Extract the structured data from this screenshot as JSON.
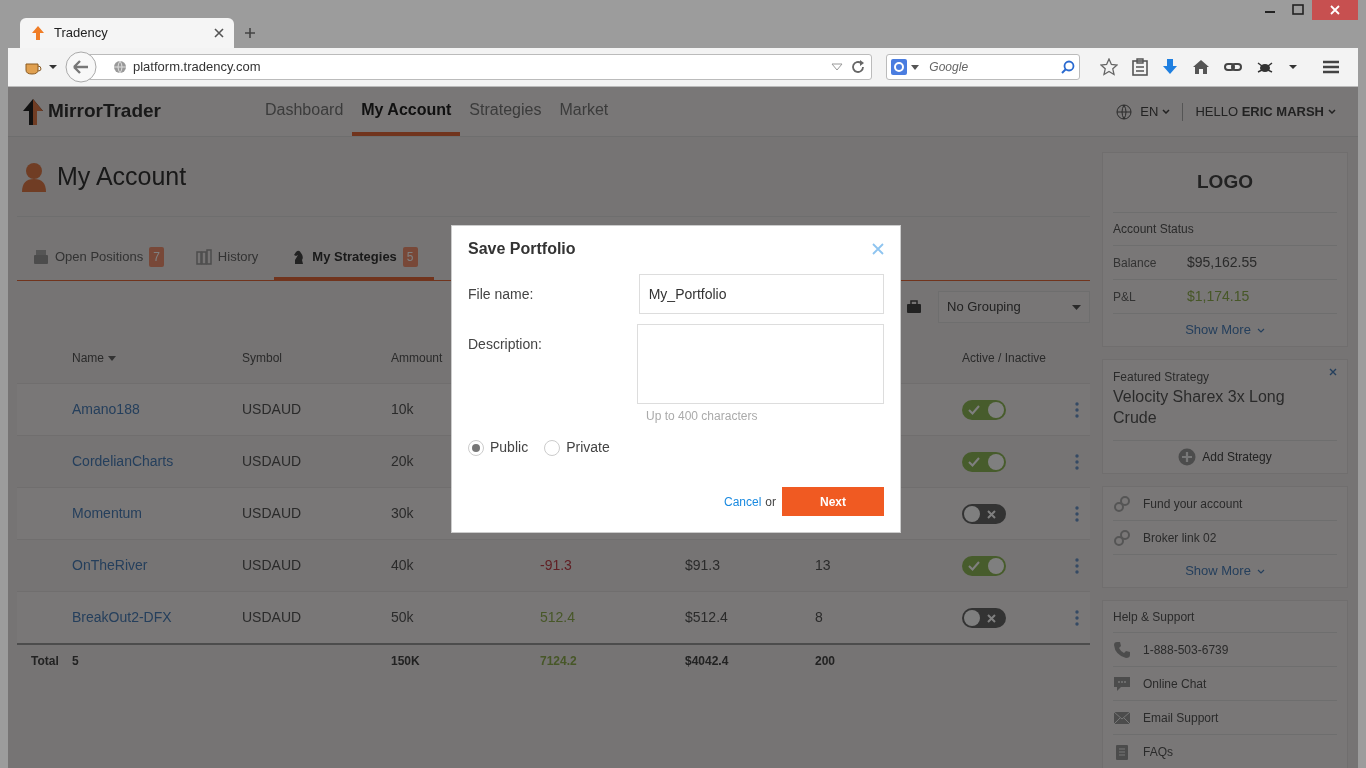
{
  "browser": {
    "tab_title": "Tradency",
    "url": "platform.tradency.com",
    "search_placeholder": "Google"
  },
  "app": {
    "brand": "MirrorTrader",
    "nav": [
      {
        "label": "Dashboard",
        "selected": false
      },
      {
        "label": "My Account",
        "selected": true
      },
      {
        "label": "Strategies",
        "selected": false
      },
      {
        "label": "Market",
        "selected": false
      }
    ],
    "language": "EN",
    "greeting": "HELLO **ERIC MARSH**"
  },
  "page_title": "My Account",
  "tabs": [
    {
      "kind": "printer",
      "label": "Open Positions",
      "count": "7",
      "selected": false
    },
    {
      "kind": "binders",
      "label": "History",
      "selected": false
    },
    {
      "kind": "chess",
      "label": "My Strategies",
      "count": "5",
      "selected": true
    }
  ],
  "grouping": "No Grouping",
  "table": {
    "columns": [
      {
        "label": "Name",
        "sorted": true
      },
      {
        "label": "Symbol",
        "sorted": false
      },
      {
        "label": "Ammount",
        "sorted": false
      },
      {
        "label": "Active / Inactive",
        "sorted": false
      }
    ],
    "rows": [
      {
        "name": "Amano188",
        "symbol": "USDAUD",
        "amount": "10k",
        "active": true
      },
      {
        "name": "CordelianCharts",
        "symbol": "USDAUD",
        "amount": "20k",
        "active": true
      },
      {
        "name": "Momentum",
        "symbol": "USDAUD",
        "amount": "30k",
        "active": false
      },
      {
        "name": "OnTheRiver",
        "symbol": "USDAUD",
        "amount": "40k",
        "column_4": "-91.3",
        "gain": false,
        "column_5": "$91.3",
        "column_6": "13",
        "active": true
      },
      {
        "name": "BreakOut2-DFX",
        "symbol": "USDAUD",
        "amount": "50k",
        "column_4": "512.4",
        "gain": true,
        "column_5": "$512.4",
        "column_6": "8",
        "active": false
      }
    ],
    "total": {
      "label": "Total",
      "count": "5",
      "amount": "150K",
      "column_4": "7124.2",
      "column_5": "$4042.4",
      "column_6": "200"
    }
  },
  "sidebar": {
    "logo": "LOGO",
    "account_status": {
      "title": "Account Status",
      "rows": [
        {
          "label": "Balance",
          "value": "$95,162.55"
        },
        {
          "label": "P&L",
          "value": "$1,174.15",
          "gain": true
        }
      ],
      "show_more": "Show More"
    },
    "featured": {
      "title": "Featured Strategy",
      "name": "Velocity Sharex 3x Long Crude",
      "action": "Add Strategy"
    },
    "links": {
      "items": [
        "Fund your account",
        "Broker link 02"
      ],
      "show_more": "Show More"
    },
    "help": {
      "title": "Help & Support",
      "items": [
        {
          "kind": "phone",
          "label": "1-888-503-6739"
        },
        {
          "kind": "chat",
          "label": "Online Chat"
        },
        {
          "kind": "email",
          "label": "Email Support"
        },
        {
          "kind": "faq",
          "label": "FAQs"
        }
      ]
    }
  },
  "modal": {
    "title": "Save Portfolio",
    "file_name_label": "File name:",
    "file_name": "My_Portfolio",
    "description_label": "Description:",
    "description_hint": "Up to 400 characters",
    "visibility": [
      {
        "label": "Public",
        "selected": true
      },
      {
        "label": "Private",
        "selected": false
      }
    ],
    "cancel": "Cancel",
    "or": "or",
    "next": "Next"
  }
}
